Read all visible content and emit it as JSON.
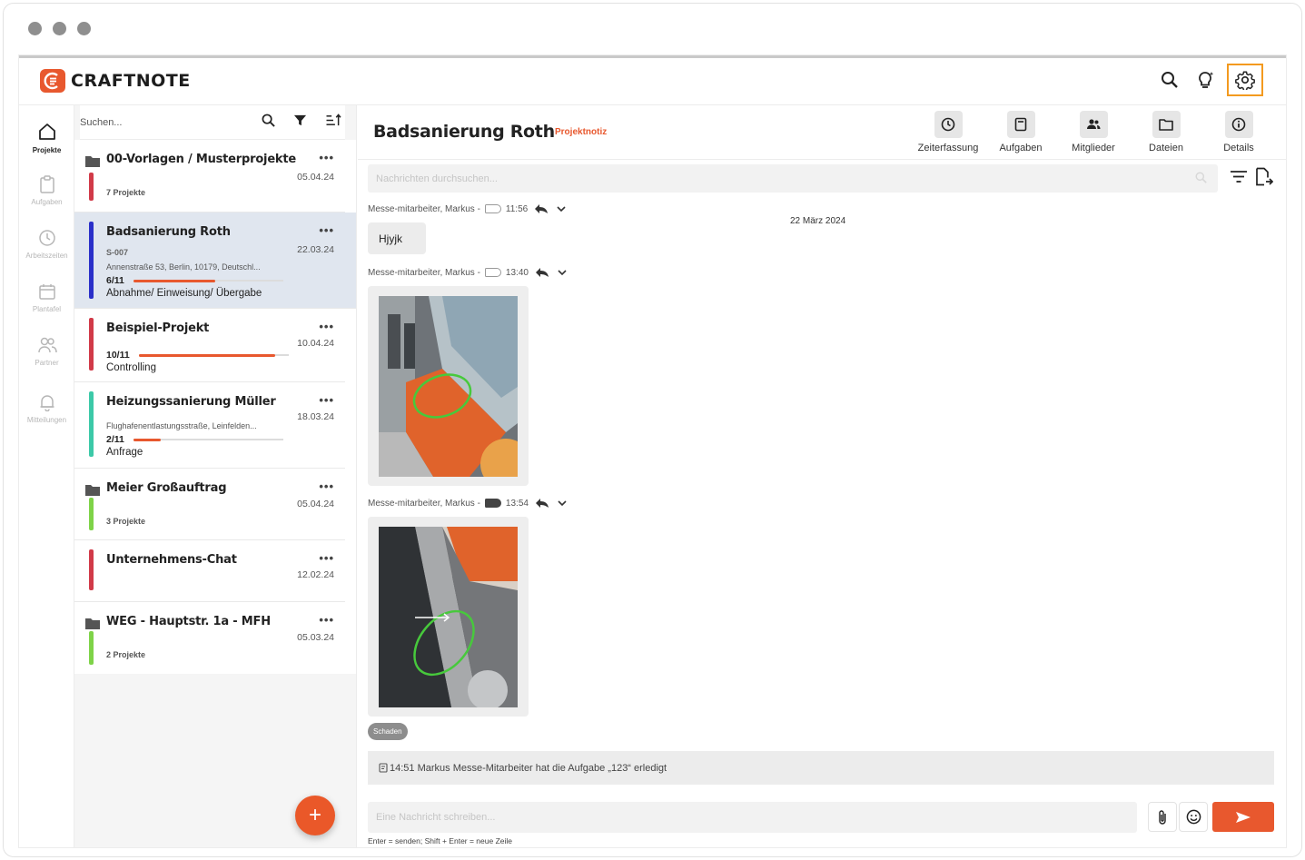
{
  "app": {
    "brand": "CRAFTNOTE",
    "accent_color": "#e8582e",
    "highlight_color": "#f39a1f"
  },
  "topbar": {
    "icons": [
      "search-icon",
      "lightbulb-icon",
      "gear-icon"
    ]
  },
  "leftnav": {
    "items": [
      {
        "label": "Projekte",
        "icon": "home-icon",
        "active": true
      },
      {
        "label": "Aufgaben",
        "icon": "clipboard-icon",
        "active": false
      },
      {
        "label": "Arbeitszeiten",
        "icon": "clock-icon",
        "active": false
      },
      {
        "label": "Plantafel",
        "icon": "calendar-icon",
        "active": false
      },
      {
        "label": "Partner",
        "icon": "people-icon",
        "active": false
      },
      {
        "label": "Mitteilungen",
        "icon": "bell-icon",
        "active": false
      }
    ]
  },
  "projectlist": {
    "search_placeholder": "Suchen...",
    "items": [
      {
        "type": "folder",
        "title": "00-Vorlagen / Musterprojekte",
        "date": "05.04.24",
        "sub": "7 Projekte",
        "color": "#d13a48",
        "dots": "•••"
      },
      {
        "type": "project",
        "title": "Badsanierung Roth",
        "date": "22.03.24",
        "code": "S-007",
        "address": "Annenstraße 53, Berlin, 10179, Deutschl...",
        "progress_label": "6/11",
        "progress": 0.545,
        "status": "Abnahme/ Einweisung/ Übergabe",
        "color": "#2a2fc9",
        "dots": "•••",
        "selected": true
      },
      {
        "type": "project",
        "title": "Beispiel-Projekt",
        "date": "10.04.24",
        "progress_label": "10/11",
        "progress": 0.909,
        "status": "Controlling",
        "color": "#d13a48",
        "dots": "•••"
      },
      {
        "type": "project",
        "title": "Heizungssanierung Müller",
        "date": "18.03.24",
        "address": "Flughafenentlastungsstraße, Leinfelden...",
        "progress_label": "2/11",
        "progress": 0.182,
        "status": "Anfrage",
        "color": "#3cc9a8",
        "dots": "•••"
      },
      {
        "type": "folder",
        "title": "Meier Großauftrag",
        "date": "05.04.24",
        "sub": "3 Projekte",
        "color": "#7ed348",
        "dots": "•••"
      },
      {
        "type": "chat",
        "title": "Unternehmens-Chat",
        "date": "12.02.24",
        "color": "#d13a48",
        "dots": "•••"
      },
      {
        "type": "folder",
        "title": "WEG - Hauptstr. 1a - MFH",
        "date": "05.03.24",
        "sub": "2 Projekte",
        "color": "#7ed348",
        "dots": "•••"
      }
    ],
    "fab_label": "+"
  },
  "main": {
    "title": "Badsanierung Roth",
    "badge": "Projektnotiz",
    "tabs": [
      {
        "label": "Zeiterfassung",
        "icon": "clock-icon"
      },
      {
        "label": "Aufgaben",
        "icon": "clipboard-icon"
      },
      {
        "label": "Mitglieder",
        "icon": "people-icon"
      },
      {
        "label": "Dateien",
        "icon": "folder-icon"
      },
      {
        "label": "Details",
        "icon": "info-icon"
      }
    ],
    "search_placeholder": "Nachrichten durchsuchen...",
    "date_separator": "22 März 2024",
    "messages": [
      {
        "author": "Messe-mitarbeiter, Markus -",
        "time": "11:56",
        "text": "Hjyjk"
      },
      {
        "author": "Messe-mitarbeiter, Markus -",
        "time": "13:40"
      },
      {
        "author": "Messe-mitarbeiter, Markus -",
        "time": "13:54",
        "tag": "Schaden"
      }
    ],
    "system_message": "14:51 Markus Messe-Mitarbeiter hat die Aufgabe „123“ erledigt",
    "composer_placeholder": "Eine Nachricht schreiben...",
    "hint": "Enter = senden; Shift + Enter = neue Zeile"
  }
}
